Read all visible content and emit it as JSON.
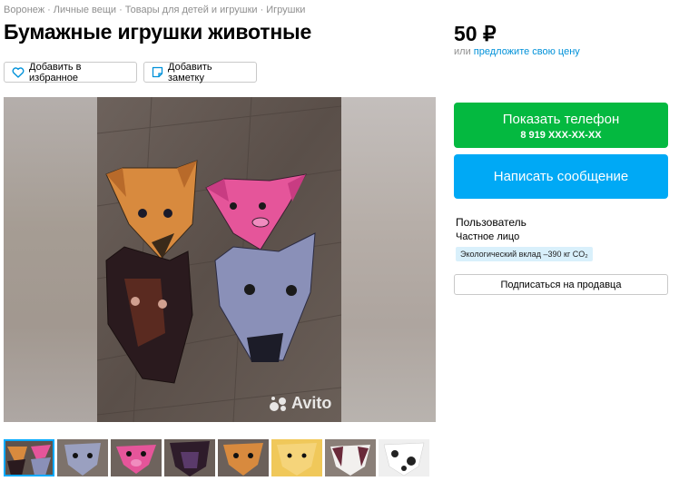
{
  "breadcrumbs": {
    "items": [
      "Воронеж",
      "Личные вещи",
      "Товары для детей и игрушки",
      "Игрушки"
    ],
    "separator": "·"
  },
  "listing": {
    "title": "Бумажные игрушки животные",
    "price": "50 ₽",
    "price_prefix": "или",
    "price_offer_link": "предложите свою цену"
  },
  "actions": {
    "favorite_label": "Добавить в избранное",
    "note_label": "Добавить заметку"
  },
  "gallery": {
    "watermark": "Avito",
    "thumbnail_count": 8,
    "active_thumbnail": 1
  },
  "contact": {
    "phone_label": "Показать телефон",
    "phone_masked": "8 919 XXX-XX-XX",
    "message_label": "Написать сообщение"
  },
  "seller": {
    "name": "Пользователь",
    "type": "Частное лицо",
    "eco_badge": "Экологический вклад –390 кг CO₂",
    "subscribe_label": "Подписаться на продавца"
  },
  "colors": {
    "phone_button": "#04b940",
    "message_button": "#00a9f5",
    "link": "#0091d9",
    "eco_badge_bg": "#d9f0fb",
    "active_thumb_border": "#00aaff"
  },
  "icons": [
    "heart-icon",
    "note-icon",
    "avito-logo-icon"
  ]
}
